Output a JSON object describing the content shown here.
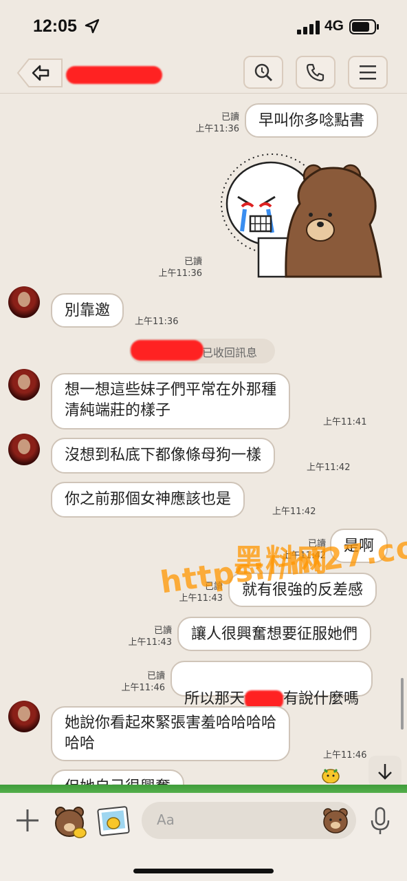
{
  "status_bar": {
    "time": "12:05",
    "network": "4G"
  },
  "header": {
    "back_icon": "back-arrow-icon",
    "search_icon": "search-icon",
    "call_icon": "phone-icon",
    "menu_icon": "hamburger-menu-icon"
  },
  "messages": [
    {
      "side": "out",
      "text": "早叫你多唸點書",
      "read": "已讀",
      "time": "上午11:36"
    },
    {
      "side": "out",
      "type": "sticker",
      "read": "已讀",
      "time": "上午11:36"
    },
    {
      "side": "in",
      "text": "別靠邀",
      "time": "上午11:36"
    },
    {
      "side": "system",
      "text": "已收回訊息"
    },
    {
      "side": "in",
      "text": "想一想這些妹子們平常在外那種\n清純端莊的樣子",
      "time": "上午11:41"
    },
    {
      "side": "in",
      "text": "沒想到私底下都像條母狗一樣",
      "time": "上午11:42"
    },
    {
      "side": "in",
      "text": "你之前那個女神應該也是",
      "time": "上午11:42"
    },
    {
      "side": "out",
      "text": "是啊",
      "read": "已讀",
      "time": "上午11:42"
    },
    {
      "side": "out",
      "text": "就有很強的反差感",
      "read": "已讀",
      "time": "上午11:43"
    },
    {
      "side": "out",
      "text": "讓人很興奮想要征服她們",
      "read": "已讀",
      "time": "上午11:43"
    },
    {
      "side": "out",
      "text_before": "所以那天",
      "text_after": "有說什麼嗎",
      "read": "已讀",
      "time": "上午11:46"
    },
    {
      "side": "in",
      "text": "她說你看起來緊張害羞哈哈哈哈\n哈哈",
      "time": "上午11:46"
    },
    {
      "side": "in",
      "text": "但她自己很興奮"
    }
  ],
  "watermark": {
    "line1": "黑料网",
    "line2": "https://hl27.co"
  },
  "input": {
    "placeholder": "Aa"
  },
  "colors": {
    "background": "#efe9e1",
    "bubble": "#ffffff",
    "bubble_border": "#cfc4b8",
    "redaction": "#ff2222"
  }
}
